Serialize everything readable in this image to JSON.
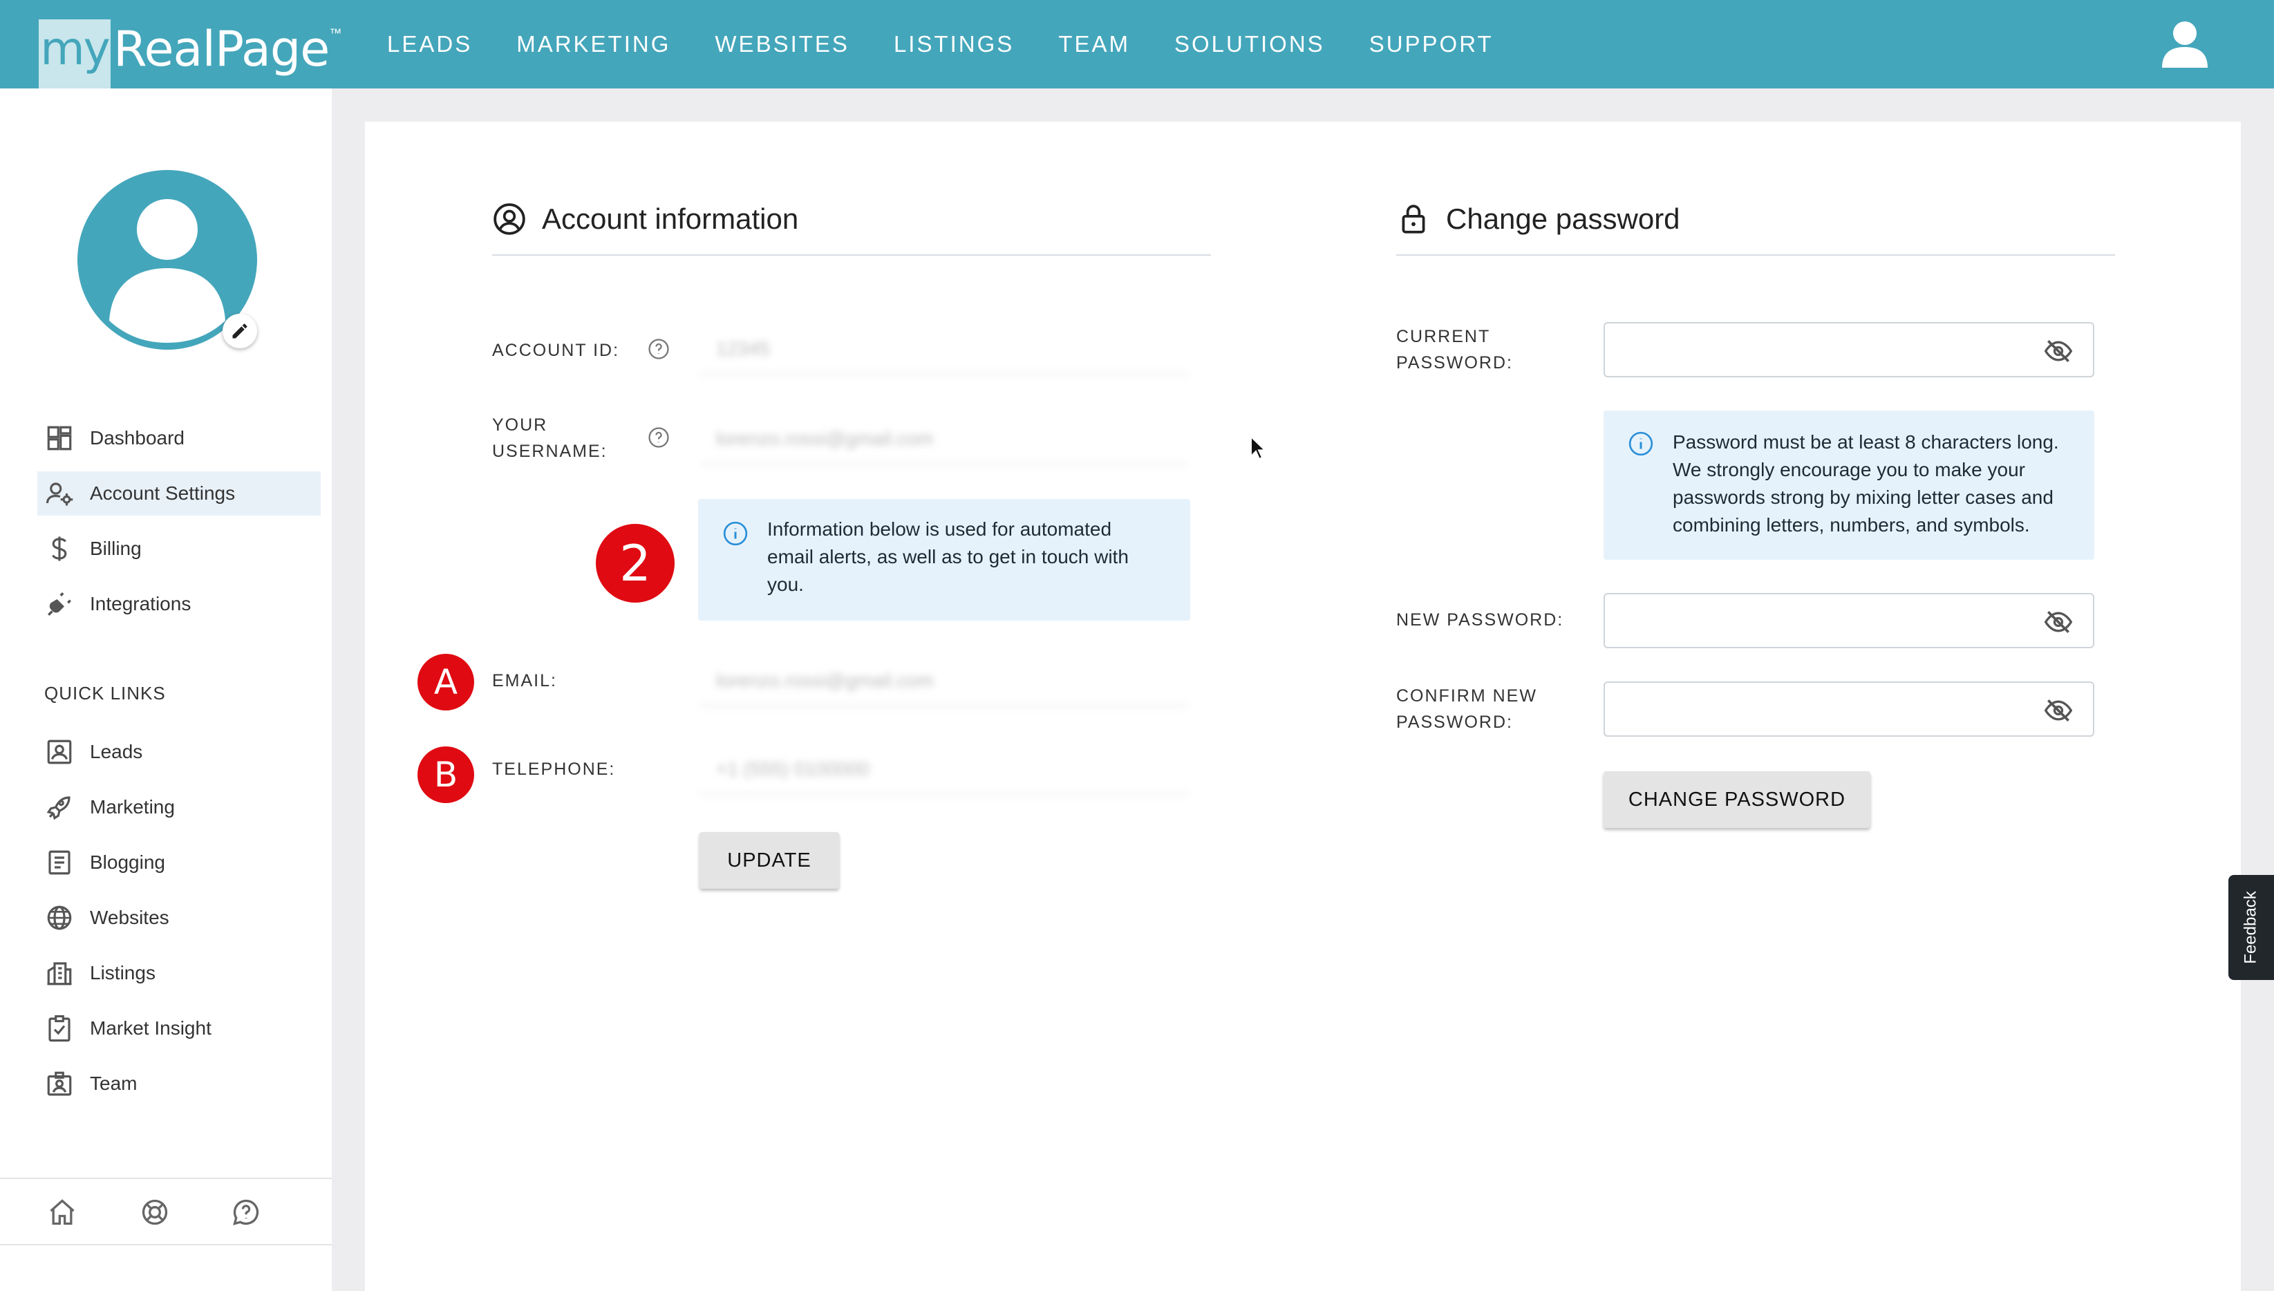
{
  "header": {
    "logo_my": "my",
    "logo_rest": "RealPage",
    "logo_tm": "™",
    "nav": [
      "LEADS",
      "MARKETING",
      "WEBSITES",
      "LISTINGS",
      "TEAM",
      "SOLUTIONS",
      "SUPPORT"
    ]
  },
  "sidebar": {
    "items": [
      {
        "label": "Dashboard",
        "icon": "dashboard-icon"
      },
      {
        "label": "Account Settings",
        "icon": "account-settings-icon",
        "active": true
      },
      {
        "label": "Billing",
        "icon": "dollar-icon"
      },
      {
        "label": "Integrations",
        "icon": "plug-icon"
      }
    ],
    "quick_links_title": "QUICK LINKS",
    "quick_links": [
      {
        "label": "Leads",
        "icon": "contact-card-icon"
      },
      {
        "label": "Marketing",
        "icon": "rocket-icon"
      },
      {
        "label": "Blogging",
        "icon": "document-icon"
      },
      {
        "label": "Websites",
        "icon": "globe-icon"
      },
      {
        "label": "Listings",
        "icon": "building-icon"
      },
      {
        "label": "Market Insight",
        "icon": "clipboard-check-icon"
      },
      {
        "label": "Team",
        "icon": "badge-icon"
      }
    ],
    "footer_icons": [
      "home-icon",
      "lifebuoy-icon",
      "help-chat-icon"
    ]
  },
  "account": {
    "title": "Account information",
    "account_id_label": "ACCOUNT ID:",
    "account_id_value": "12345",
    "username_label_1": "YOUR",
    "username_label_2": "USERNAME:",
    "username_value": "lorenzo.rossi@gmail.com",
    "info_text_1": "Information below is used for automated",
    "info_text_2": "email alerts, as well as to get in touch with",
    "info_text_3": "you.",
    "email_label": "EMAIL:",
    "email_value": "lorenzo.rossi@gmail.com",
    "telephone_label": "TELEPHONE:",
    "telephone_value": "+1 (555) 0100000",
    "update_button": "UPDATE"
  },
  "password": {
    "title": "Change password",
    "current_label_1": "CURRENT",
    "current_label_2": "PASSWORD:",
    "info_1": "Password must be at least 8 characters long.",
    "info_2": "We strongly encourage you to make your",
    "info_3": "passwords strong by mixing letter cases and",
    "info_4": "combining letters, numbers, and symbols.",
    "new_label": "NEW PASSWORD:",
    "confirm_label_1": "CONFIRM NEW",
    "confirm_label_2": "PASSWORD:",
    "change_button": "CHANGE PASSWORD"
  },
  "annotations": {
    "step": "2",
    "a": "A",
    "b": "B"
  },
  "feedback_label": "Feedback",
  "colors": {
    "brand": "#44a6bb",
    "annotation_red": "#e00a12",
    "info_bg": "#e6f2fb"
  }
}
